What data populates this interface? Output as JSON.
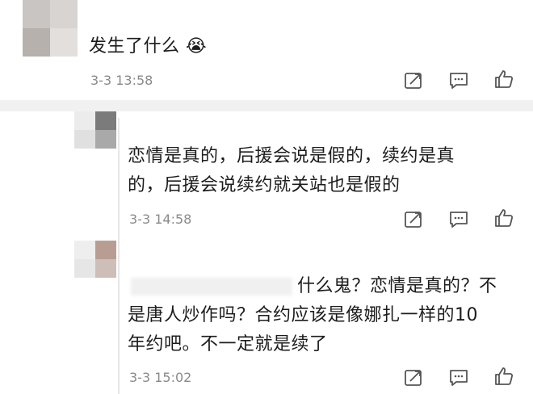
{
  "comments": [
    {
      "text": "发生了什么 😭",
      "time": "3-3 13:58"
    },
    {
      "text_line1": "恋情是真的，后援会说是假的，续约是真",
      "text_line2": "的，后援会说续约就关站也是假的",
      "time": "3-3 14:58"
    },
    {
      "text_line1": "什么鬼？恋情是真的？不",
      "text_line2": "是唐人炒作吗？合约应该是像娜扎一样的10",
      "text_line3": "年约吧。不一定就是续了",
      "time": "3-3 15:02"
    }
  ],
  "icons": {
    "share": "share-icon",
    "comment": "comment-icon",
    "like": "thumbs-up-icon"
  },
  "colors": {
    "divider": "#f1f1f1",
    "time": "#8a8a8a",
    "icon": "#555555"
  }
}
